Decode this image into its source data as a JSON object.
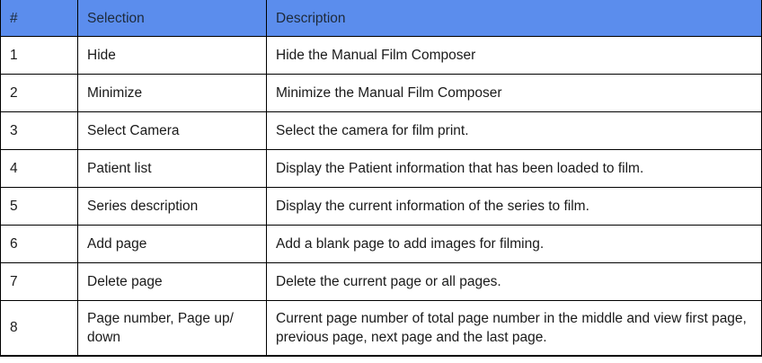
{
  "table": {
    "headers": [
      "#",
      "Selection",
      "Description"
    ],
    "header_color": "#5b8ded",
    "rows": [
      {
        "num": "1",
        "selection": "Hide",
        "description": "Hide the Manual Film Composer"
      },
      {
        "num": "2",
        "selection": "Minimize",
        "description": "Minimize the Manual Film Composer"
      },
      {
        "num": "3",
        "selection": "Select Camera",
        "description": "Select the camera for film print."
      },
      {
        "num": "4",
        "selection": "Patient list",
        "description": "Display the Patient information that has been loaded to film."
      },
      {
        "num": "5",
        "selection": "Series description",
        "description": "Display the current information of the series to film."
      },
      {
        "num": "6",
        "selection": "Add page",
        "description": "Add a blank page to add images for filming."
      },
      {
        "num": "7",
        "selection": "Delete page",
        "description": "Delete the current page or all pages."
      },
      {
        "num": "8",
        "selection": "Page number, Page up/ down",
        "description": "Current page number of total page number in the middle and view first page, previous page, next page and the last page."
      }
    ]
  }
}
